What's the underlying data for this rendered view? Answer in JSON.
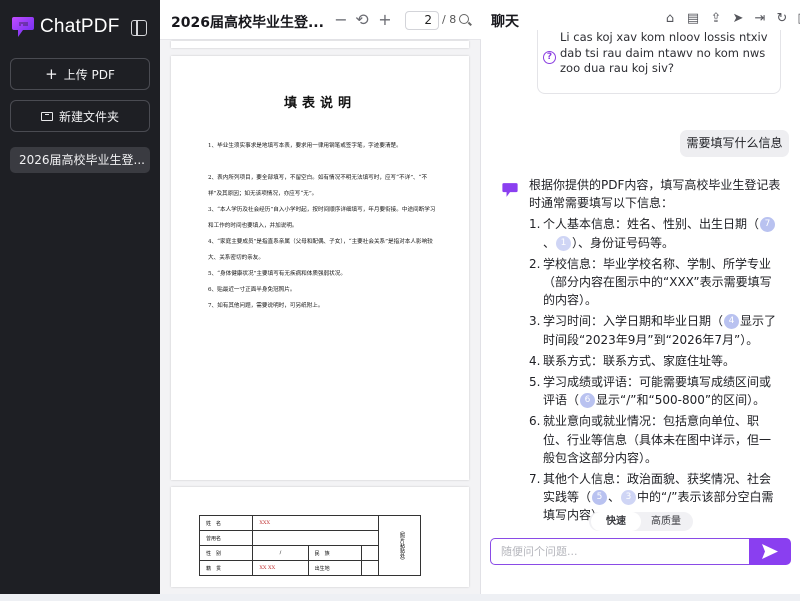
{
  "sidebar": {
    "brand": "ChatPDF",
    "upload_label": "上传 PDF",
    "new_folder_label": "新建文件夹",
    "file_item": "2026届高校毕业生登..."
  },
  "viewer": {
    "title": "2026届高校毕业生登...",
    "page_current": "2",
    "page_total": "/ 8",
    "page2": {
      "heading": "填表说明",
      "paragraphs": [
        "1、毕业生须实事求是地填写本表，要求用一律用钢笔或签字笔，字迹要清楚。",
        "2、表内所列项目，要全部填写，不留空白。如有情况不明无法填写时，应写“不详”、“不祥”及其原因；如无该项情况，亦应写“无”。",
        "3、“本人学历及社会经历”自入小学时起，按时间顺序详细填写，年月要衔接。中途间断学习和工作的时间也要填入，并加说明。",
        "4、“家庭主要成员”是指直系亲属（父母和配偶、子女），“主要社会关系”是指对本人影响较大、关系密切的亲友。",
        "5、“身体健康状况”主要填写有无疾病和体质强弱状况。",
        "6、贴最近一寸正面半身免冠照片。",
        "7、如有其他问题，需要说明时，可另纸附上。"
      ]
    },
    "page3": {
      "rows": [
        [
          "姓　名",
          "XXX",
          "",
          ""
        ],
        [
          "曾用名",
          "",
          "",
          ""
        ],
        [
          "性　别",
          "/",
          "民　族",
          ""
        ],
        [
          "籍　贯",
          "XX XX",
          "出生地",
          ""
        ]
      ],
      "photo_label": "（照片粘贴处）"
    }
  },
  "chat": {
    "title": "聊天",
    "suggestion_text": "Li cas koj xav kom nloov lossis ntxiv dab tsi rau daim ntawv no kom nws zoo dua rau koj siv?",
    "user_message": "需要填写什么信息",
    "bot_intro": "根据你提供的PDF内容，填写高校毕业生登记表时通常需要填写以下信息：",
    "bot_items": [
      {
        "num": "1.",
        "pre": "个人基本信息：姓名、性别、出生日期（",
        "cites": [
          "7",
          "1"
        ],
        "post": "）、身份证号码等。"
      },
      {
        "num": "2.",
        "pre": "学校信息：毕业学校名称、学制、所学专业（部分内容在图示中的“XXX”表示需要填写的内容）。",
        "cites": [],
        "post": ""
      },
      {
        "num": "3.",
        "pre": "学习时间：入学日期和毕业日期（",
        "cites": [
          "4"
        ],
        "post": "显示了时间段“2023年9月”到“2026年7月”）。"
      },
      {
        "num": "4.",
        "pre": "联系方式：联系方式、家庭住址等。",
        "cites": [],
        "post": ""
      },
      {
        "num": "5.",
        "pre": "学习成绩或评语：可能需要填写成绩区间或评语（",
        "cites": [
          "6"
        ],
        "post": "显示“/”和“500-800”的区间）。"
      },
      {
        "num": "6.",
        "pre": "就业意向或就业情况：包括意向单位、职位、行业等信息（具体未在图中详示，但一般包含这部分内容）。",
        "cites": [],
        "post": ""
      },
      {
        "num": "7.",
        "pre": "其他个人信息：政治面貌、获奖情况、社会实践等（",
        "cites": [
          "5",
          "3"
        ],
        "post": "中的“/”表示该部分空白需填写内容）。"
      }
    ],
    "mode_fast": "快速",
    "mode_quality": "高质量",
    "input_placeholder": "随便问个问题...",
    "accent": "#8a3ff0"
  }
}
